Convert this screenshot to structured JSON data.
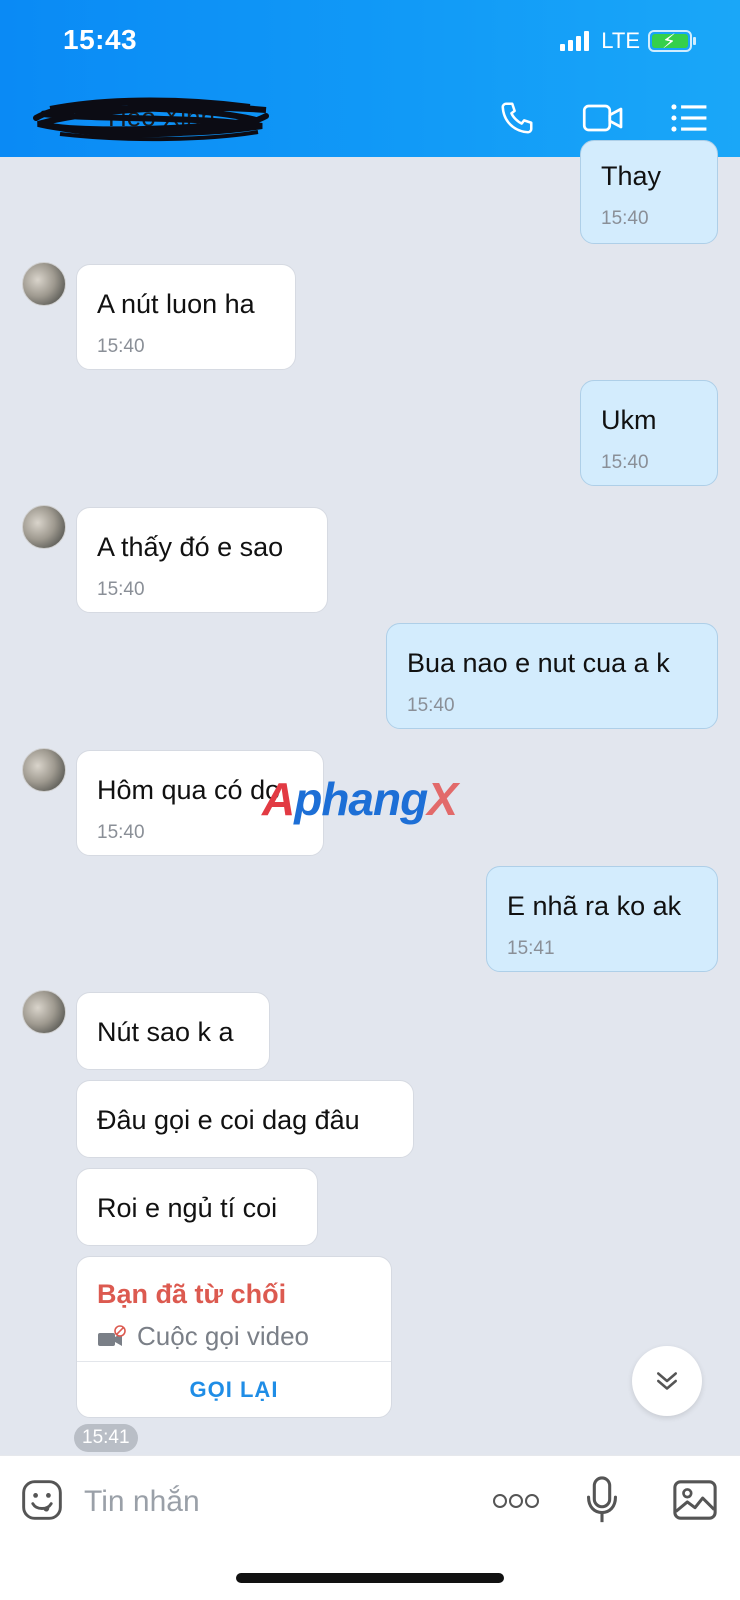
{
  "status": {
    "time": "15:43",
    "network": "LTE"
  },
  "header": {
    "contact_name": "Heo Xinh"
  },
  "messages": [
    {
      "dir": "out",
      "text": "Thay",
      "time": "15:40"
    },
    {
      "dir": "in",
      "text": "A nút luon ha",
      "time": "15:40"
    },
    {
      "dir": "out",
      "text": "Ukm",
      "time": "15:40"
    },
    {
      "dir": "in",
      "text": "A thấy đó e sao",
      "time": "15:40"
    },
    {
      "dir": "out",
      "text": "Bua nao e nut cua a k",
      "time": "15:40"
    },
    {
      "dir": "in",
      "text": "Hôm qua có do",
      "time": "15:40"
    },
    {
      "dir": "out",
      "text": "E nhã ra ko ak",
      "time": "15:41"
    },
    {
      "dir": "in",
      "text": "Nút sao k a"
    },
    {
      "dir": "in",
      "text": "Đâu gọi e coi dag đâu"
    },
    {
      "dir": "in",
      "text": "Roi e ngủ tí coi"
    }
  ],
  "call_card": {
    "title": "Bạn đã từ chối",
    "subtitle": "Cuộc gọi video",
    "action": "GỌI LẠI",
    "time": "15:41"
  },
  "watermark": {
    "part1": "A",
    "part2": "phang",
    "part3": "X"
  },
  "input": {
    "placeholder": "Tin nhắn"
  },
  "icons": {
    "phone": "phone-icon",
    "video": "video-camera-icon",
    "menu": "list-menu-icon",
    "emoji": "emoji-icon",
    "more": "more-options-icon",
    "mic": "microphone-icon",
    "image": "image-icon",
    "scroll": "double-chevron-down-icon"
  },
  "colors": {
    "header": "#0a8af5",
    "out_bubble": "#d3ecfd",
    "in_bubble": "#ffffff",
    "declined": "#dc5a50",
    "link": "#1f8de6"
  }
}
